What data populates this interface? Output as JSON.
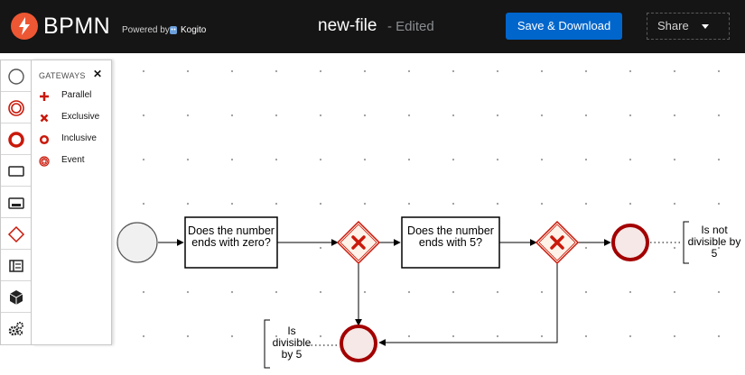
{
  "header": {
    "app_name": "BPMN",
    "powered_by": "Powered by",
    "powered_brand": "Kogito",
    "file_name": "new-file",
    "status": "- Edited",
    "save_label": "Save & Download",
    "share_label": "Share"
  },
  "palette": {
    "items": [
      "start-events",
      "intermediate-events",
      "end-events",
      "activities",
      "subprocesses",
      "gateways",
      "containers",
      "artifacts",
      "custom-tasks"
    ],
    "selected": "gateways"
  },
  "flyout": {
    "title": "GATEWAYS",
    "items": [
      {
        "label": "Parallel"
      },
      {
        "label": "Exclusive"
      },
      {
        "label": "Inclusive"
      },
      {
        "label": "Event"
      }
    ]
  },
  "diagram": {
    "task1": "Does the number ends with zero?",
    "task2": "Does the number ends with 5?",
    "annotation_not_divisible": "Is not divisible by 5",
    "annotation_divisible": "Is divisible by 5"
  },
  "colors": {
    "header_bg": "#151515",
    "brand": "#ee5733",
    "primary": "#0066cc",
    "gateway_stroke": "#c9190b",
    "end_event_stroke": "#a30000"
  }
}
